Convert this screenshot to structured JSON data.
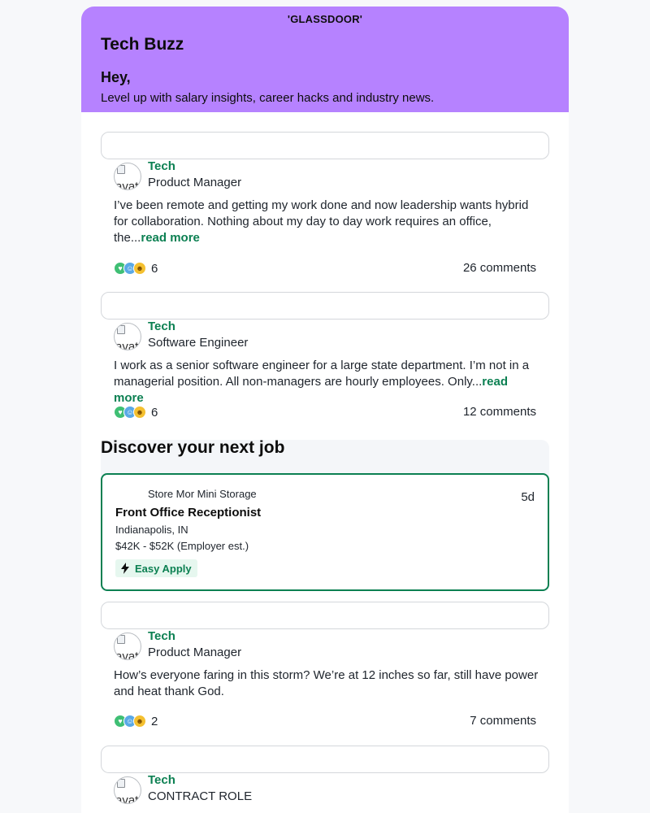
{
  "header": {
    "logo": "'GLASSDOOR'",
    "title": "Tech Buzz",
    "greeting": "Hey,",
    "subtitle": "Level up with salary insights, career hacks and industry news."
  },
  "posts": [
    {
      "avatar_alt": "avat",
      "community": "Tech",
      "role": "Product Manager",
      "body": "I’ve been remote and getting my work done and now leadership wants hybrid for collaboration. Nothing about my day to day work requires an office, the...",
      "read_more": "read more",
      "reaction_count": "6",
      "comments": "26 comments"
    },
    {
      "avatar_alt": "avat",
      "community": "Tech",
      "role": "Software Engineer",
      "body": "I work as a senior software engineer for a large state department. I’m not in a managerial position. All non-managers are hourly employees. Only...",
      "read_more": "read more",
      "reaction_count": "6",
      "comments": "12 comments"
    },
    {
      "avatar_alt": "avat",
      "community": "Tech",
      "role": "Product Manager",
      "body": "How’s everyone faring in this storm? We’re at 12 inches so far, still have power and heat thank God.",
      "reaction_count": "2",
      "comments": "7 comments"
    },
    {
      "avatar_alt": "avat",
      "community": "Tech",
      "role": "CONTRACT ROLE"
    }
  ],
  "reaction_icons": [
    "heart-reaction-icon",
    "wow-reaction-icon",
    "haha-reaction-icon"
  ],
  "jobs_section": {
    "title": "Discover your next job",
    "job": {
      "company": "Store Mor Mini Storage",
      "age": "5d",
      "title": "Front Office Receptionist",
      "location": "Indianapolis, IN",
      "salary": "$42K - $52K (Employer est.)",
      "badge": "Easy Apply"
    }
  },
  "colors": {
    "hero": "#b682ff",
    "accent_green": "#0c8052",
    "page_bg": "#f7f8fa",
    "easy_apply_bg": "#e6f7ef"
  }
}
